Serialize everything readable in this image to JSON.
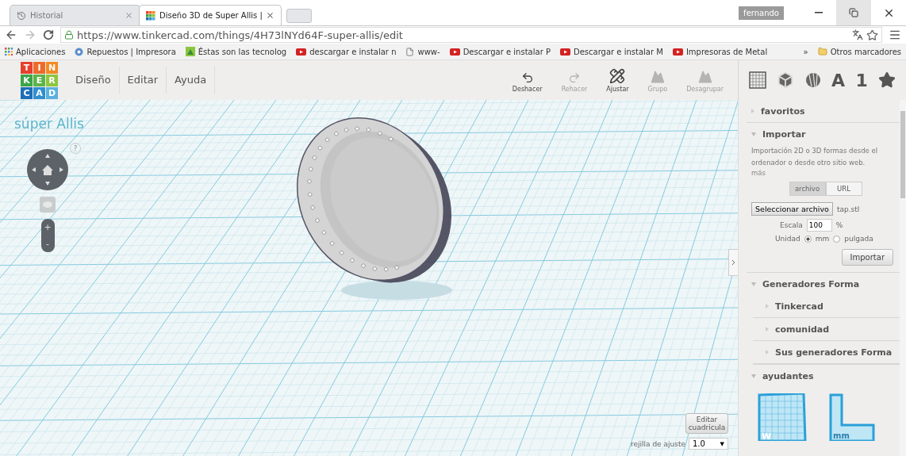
{
  "browser": {
    "tabs": [
      {
        "label": "Historial",
        "selected": false
      },
      {
        "label": "Diseño 3D de Super Allis |",
        "selected": true
      }
    ],
    "user": "fernando",
    "url": "https://www.tinkercad.com/things/4H73lNYd64F-super-allis/edit",
    "bookmarks": [
      {
        "kind": "apps",
        "label": "Aplicaciones"
      },
      {
        "kind": "site",
        "label": "Repuestos | Impresora"
      },
      {
        "kind": "leaf",
        "label": "Éstas son las tecnolog"
      },
      {
        "kind": "video",
        "label": "descargar e instalar n"
      },
      {
        "kind": "page",
        "label": "www-"
      },
      {
        "kind": "video",
        "label": "Descargar e instalar P"
      },
      {
        "kind": "video",
        "label": "Descargar e instalar M"
      },
      {
        "kind": "video",
        "label": "Impresoras de Metal"
      }
    ],
    "overflow": "»",
    "other": "Otros marcadores"
  },
  "app": {
    "logo": [
      {
        "letter": "T",
        "color": "#e5412d"
      },
      {
        "letter": "I",
        "color": "#ef6a2a"
      },
      {
        "letter": "N",
        "color": "#f48a25"
      },
      {
        "letter": "K",
        "color": "#3aa547"
      },
      {
        "letter": "E",
        "color": "#5cb446"
      },
      {
        "letter": "R",
        "color": "#8cc63f"
      },
      {
        "letter": "C",
        "color": "#1c6fb8"
      },
      {
        "letter": "A",
        "color": "#2f8fd0"
      },
      {
        "letter": "D",
        "color": "#5bb0e0"
      }
    ],
    "menu": [
      "Diseño",
      "Editar",
      "Ayuda"
    ],
    "tools": [
      {
        "kind": "undo",
        "label": "Deshacer",
        "disabled": false
      },
      {
        "kind": "redo",
        "label": "Rehacer",
        "disabled": true
      },
      {
        "kind": "adjust",
        "label": "Ajustar",
        "disabled": false
      },
      {
        "kind": "group",
        "label": "Grupo",
        "disabled": true
      },
      {
        "kind": "ungroup",
        "label": "Desagrupar",
        "disabled": true
      }
    ],
    "view_icons": [
      {
        "kind": "grid"
      },
      {
        "kind": "cube"
      },
      {
        "kind": "shapes"
      },
      {
        "kind": "text",
        "label": "A"
      },
      {
        "kind": "text",
        "label": "1"
      },
      {
        "kind": "star"
      }
    ]
  },
  "workplane": {
    "title": "súper Allis",
    "help": "?",
    "zoom_in": "+",
    "zoom_out": "-",
    "edit_grid": "Editar cuadricula",
    "snap_label": "rejilla de ajuste",
    "snap_value": "1.0",
    "snap_caret": "▼"
  },
  "sidebar": {
    "sections": [
      {
        "title": "favoritos",
        "expanded": false
      },
      {
        "kind": "import",
        "title": "Importar",
        "expanded": true
      },
      {
        "kind": "generators",
        "title": "Generadores Forma",
        "expanded": true,
        "children": [
          {
            "title": "Tinkercad",
            "expanded": false
          },
          {
            "title": "comunidad",
            "expanded": false
          },
          {
            "title": "Sus generadores Forma",
            "expanded": false
          }
        ]
      },
      {
        "kind": "helpers",
        "title": "ayudantes",
        "expanded": true
      }
    ],
    "import": {
      "description": "Importación 2D o 3D formas desde el ordenador o desde otro sitio web.",
      "more": "más",
      "sources": [
        {
          "label": "archivo",
          "selected": true
        },
        {
          "label": "URL",
          "selected": false
        }
      ],
      "file_button": "Seleccionar archivo",
      "file_name": "tap.stl",
      "scale_label": "Escala",
      "scale": "100",
      "scale_unit": "%",
      "unit_label": "Unidad",
      "units": [
        {
          "label": "mm",
          "selected": true
        },
        {
          "label": "pulgada",
          "selected": false
        }
      ],
      "import_button": "Importar"
    },
    "helpers": [
      {
        "kind": "workplane",
        "label": "W"
      },
      {
        "kind": "ruler",
        "label": "mm"
      }
    ]
  }
}
